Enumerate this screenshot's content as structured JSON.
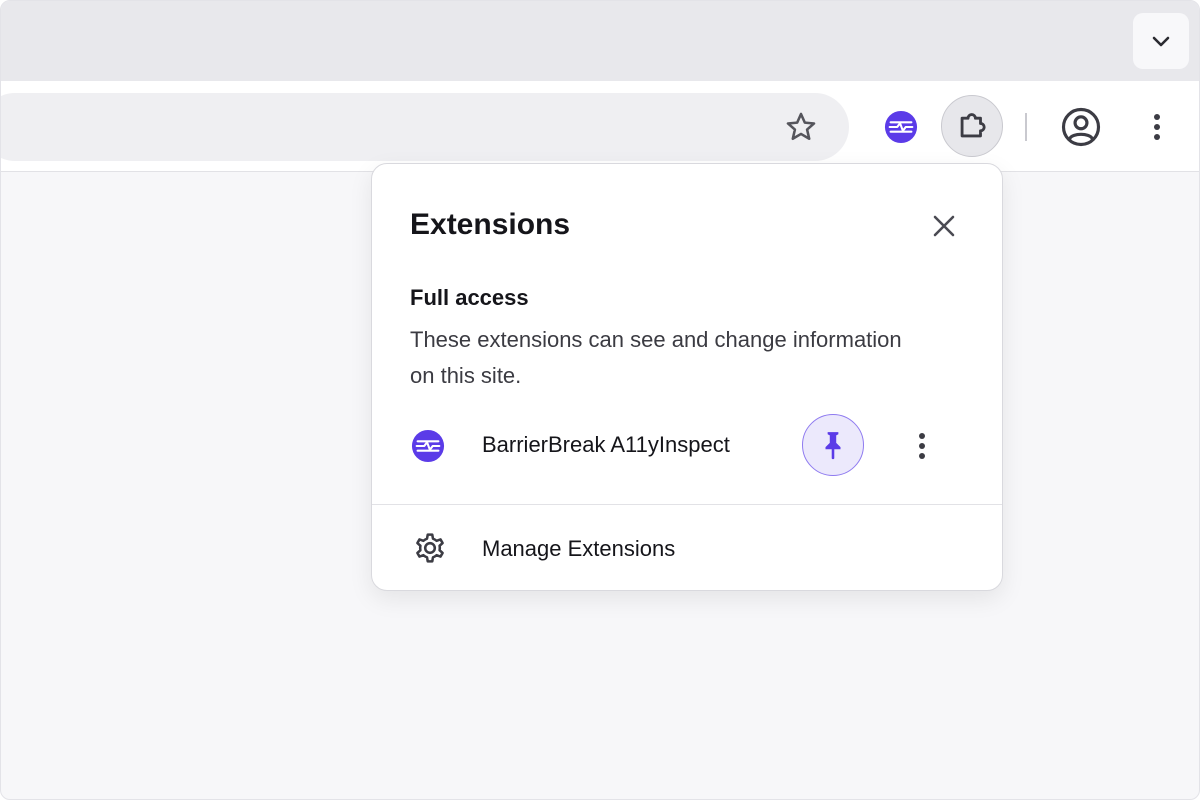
{
  "colors": {
    "accent": "#5b3be8",
    "pin_bg": "#ece9fc",
    "icon_gray": "#4a4a52",
    "tabstrip_bg": "#e8e8ec",
    "page_bg": "#f7f7f9"
  },
  "icons": {
    "tab_search": "chevron-down-icon",
    "bookmark": "star-icon",
    "extension": "a11yinspect-logo-icon",
    "extensions_menu": "puzzle-icon",
    "profile": "profile-icon",
    "browser_menu": "vertical-dots-icon",
    "close": "close-icon",
    "pin": "pin-icon",
    "more": "vertical-dots-icon",
    "settings": "gear-icon"
  },
  "popup": {
    "title": "Extensions",
    "section": {
      "heading": "Full access",
      "description": "These extensions can see and change information on this site."
    },
    "extensions": [
      {
        "name": "BarrierBreak A11yInspect",
        "pinned": true
      }
    ],
    "manage_label": "Manage Extensions"
  }
}
